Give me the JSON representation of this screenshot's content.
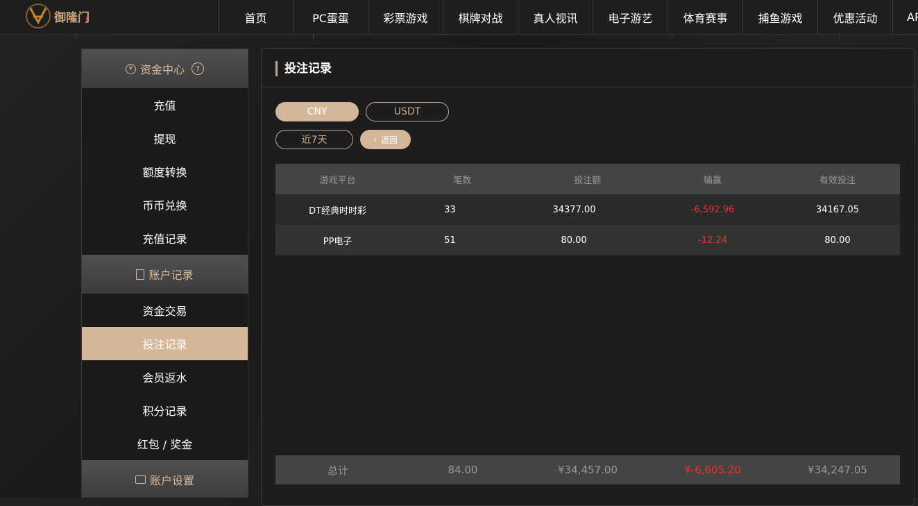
{
  "nav": {
    "logo_text": "御隆门",
    "items": [
      "首页",
      "PC蛋蛋",
      "彩票游戏",
      "棋牌对战",
      "真人视讯",
      "电子游艺",
      "体育赛事",
      "捕鱼游戏",
      "优惠活动",
      "AP"
    ]
  },
  "sidebar": {
    "section1": "资金中心",
    "section1_items": [
      "充值",
      "提现",
      "额度转换",
      "币币兑换",
      "充值记录"
    ],
    "section2": "账户记录",
    "section2_items": [
      "资金交易",
      "投注记录",
      "会员返水",
      "积分记录",
      "红包 / 奖金"
    ],
    "section3": "账户设置",
    "active": "投注记录"
  },
  "main": {
    "title": "投注记录",
    "currency": [
      "CNY",
      "USDT"
    ],
    "range_label": "近7天",
    "back_label": "返回",
    "columns": [
      "游戏平台",
      "笔数",
      "投注额",
      "输赢",
      "有效投注"
    ],
    "rows": [
      {
        "platform": "DT经典时时彩",
        "count": "33",
        "bet": "34377.00",
        "winloss": "-6,592.96",
        "valid": "34167.05"
      },
      {
        "platform": "PP电子",
        "count": "51",
        "bet": "80.00",
        "winloss": "-12.24",
        "valid": "80.00"
      }
    ],
    "total": {
      "label": "总计",
      "count": "84.00",
      "bet": "¥34,457.00",
      "winloss": "¥-6,605.20",
      "valid": "¥34,247.05"
    }
  },
  "colors": {
    "accent": "#d4b798",
    "negative": "#e8322f"
  }
}
